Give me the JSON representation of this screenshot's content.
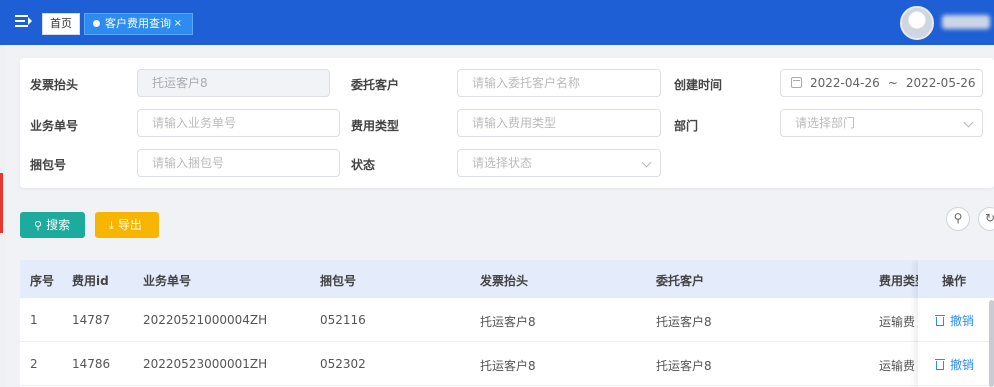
{
  "header": {
    "tabs": [
      {
        "label": "首页"
      },
      {
        "label": "客户费用查询",
        "close": "×"
      }
    ]
  },
  "filters": {
    "invoice_header": {
      "label": "发票抬头",
      "value": "托运客户8"
    },
    "client": {
      "label": "委托客户",
      "placeholder": "请输入委托客户名称"
    },
    "created_time": {
      "label": "创建时间",
      "start": "2022-04-26",
      "sep": "~",
      "end": "2022-05-26"
    },
    "business_no": {
      "label": "业务单号",
      "placeholder": "请输入业务单号"
    },
    "fee_type": {
      "label": "费用类型",
      "placeholder": "请输入费用类型"
    },
    "department": {
      "label": "部门",
      "placeholder": "请选择部门"
    },
    "package_no": {
      "label": "捆包号",
      "placeholder": "请输入捆包号"
    },
    "status": {
      "label": "状态",
      "placeholder": "请选择状态"
    }
  },
  "toolbar": {
    "search_label": "搜索",
    "export_label": "导出",
    "search_icon": "search-icon",
    "refresh_icon": "refresh-icon"
  },
  "table": {
    "columns": [
      "序号",
      "费用id",
      "业务单号",
      "捆包号",
      "发票抬头",
      "委托客户",
      "费用类型",
      "操作"
    ],
    "rows": [
      {
        "index": "1",
        "fee_id": "14787",
        "business_no": "20220521000004ZH",
        "package_no": "052116",
        "invoice_header": "托运客户8",
        "client": "托运客户8",
        "fee_type": "运输费",
        "action": "撤销"
      },
      {
        "index": "2",
        "fee_id": "14786",
        "business_no": "20220523000001ZH",
        "package_no": "052302",
        "invoice_header": "托运客户8",
        "client": "托运客户8",
        "fee_type": "运输费",
        "action": "撤销"
      }
    ]
  },
  "colors": {
    "topbar": "#1f5fd6",
    "active_tab": "#2d8cf0",
    "search_button": "#1cab9d",
    "export_button": "#f7b500",
    "table_header": "#e4ecfb",
    "link": "#2d8cf0"
  }
}
